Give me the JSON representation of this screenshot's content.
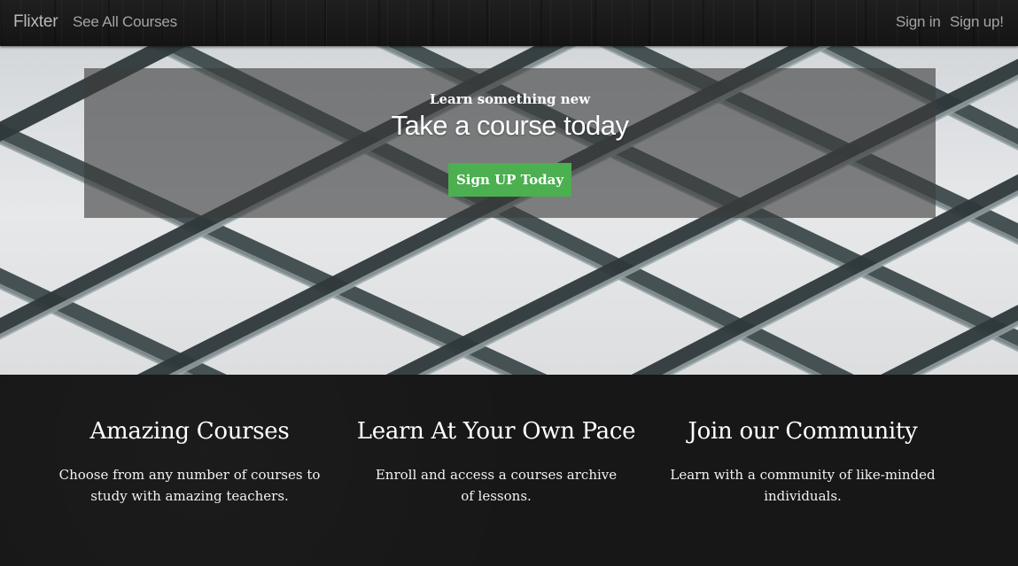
{
  "navbar": {
    "brand": "Flixter",
    "see_all": "See All Courses",
    "sign_in": "Sign in",
    "sign_up": "Sign up!"
  },
  "hero": {
    "subtitle": "Learn something new",
    "title": "Take a course today",
    "button_label": "Sign UP Today",
    "button_color": "#4caf50"
  },
  "features": [
    {
      "title": "Amazing Courses",
      "text": "Choose from any number of courses to study with amazing teachers."
    },
    {
      "title": "Learn At Your Own Pace",
      "text": "Enroll and access a courses archive of lessons."
    },
    {
      "title": "Join our Community",
      "text": "Learn with a community of like-minded individuals."
    }
  ]
}
